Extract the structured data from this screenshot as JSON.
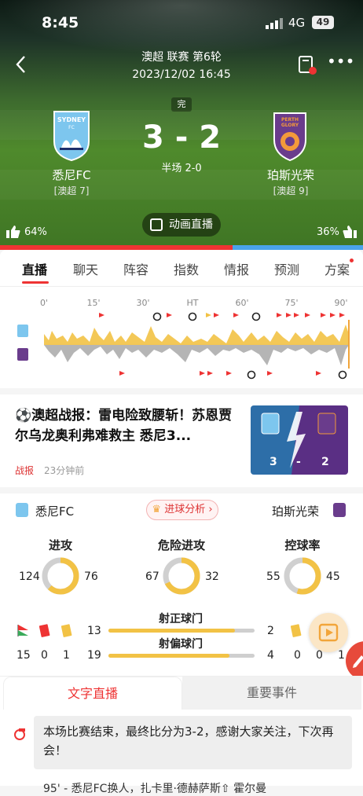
{
  "status_bar": {
    "time": "8:45",
    "network": "4G",
    "battery": "49"
  },
  "header": {
    "league_round": "澳超 联赛 第6轮",
    "datetime": "2023/12/02 16:45",
    "status": "完",
    "home": {
      "name": "悉尼FC",
      "rank": "[澳超 7]",
      "color": "#7dc6ee"
    },
    "away": {
      "name": "珀斯光荣",
      "rank": "[澳超 9]",
      "color": "#6a3c8c"
    },
    "score": "3 - 2",
    "half_time": "半场 2-0",
    "live_animation": "动画直播",
    "home_support": "64%",
    "away_support": "36%",
    "home_support_value": 64
  },
  "tabs": [
    "直播",
    "聊天",
    "阵容",
    "指数",
    "情报",
    "预测",
    "方案"
  ],
  "timeline": {
    "ticks": [
      "0'",
      "15'",
      "30'",
      "HT",
      "60'",
      "75'",
      "90'"
    ]
  },
  "news": {
    "title": "⚽澳超战报：雷电险致腰斩！苏恩贾尔乌龙奥利弗难救主 悉尼3...",
    "tag": "战报",
    "time": "23分钟前",
    "thumb_home": "3",
    "thumb_sep": "-",
    "thumb_away": "2"
  },
  "stats": {
    "home_name": "悉尼FC",
    "away_name": "珀斯光荣",
    "analysis_label": "进球分析",
    "rings": [
      {
        "label": "进攻",
        "home": "124",
        "away": "76",
        "home_value": 124,
        "away_value": 76
      },
      {
        "label": "危险进攻",
        "home": "67",
        "away": "32",
        "home_value": 67,
        "away_value": 32
      },
      {
        "label": "控球率",
        "home": "55",
        "away": "45",
        "home_value": 55,
        "away_value": 45
      }
    ],
    "home_corners": "",
    "bars": [
      {
        "label": "射正球门",
        "home": "13",
        "away": "2",
        "home_value": 13,
        "away_value": 2
      },
      {
        "label": "射偏球门",
        "home": "19",
        "away": "4",
        "home_value": 19,
        "away_value": 4
      }
    ],
    "home_counts": {
      "corners": "15",
      "red": "0",
      "yellow": "1"
    },
    "away_counts": {
      "yellow": "0",
      "red": "0",
      "corners": "1"
    }
  },
  "bottom": {
    "tab_live_text": "文字直播",
    "tab_events": "重要事件",
    "message": "本场比赛结束，最终比分为3-2，感谢大家关注，下次再会！",
    "next_line": "95' - 悉尼FC换人，扎卡里·德赫萨斯⇧ 霍尔曼"
  },
  "colors": {
    "accent": "#e33333",
    "bar_yellow": "#f2c245",
    "bar_grey": "#cfcfcf"
  }
}
